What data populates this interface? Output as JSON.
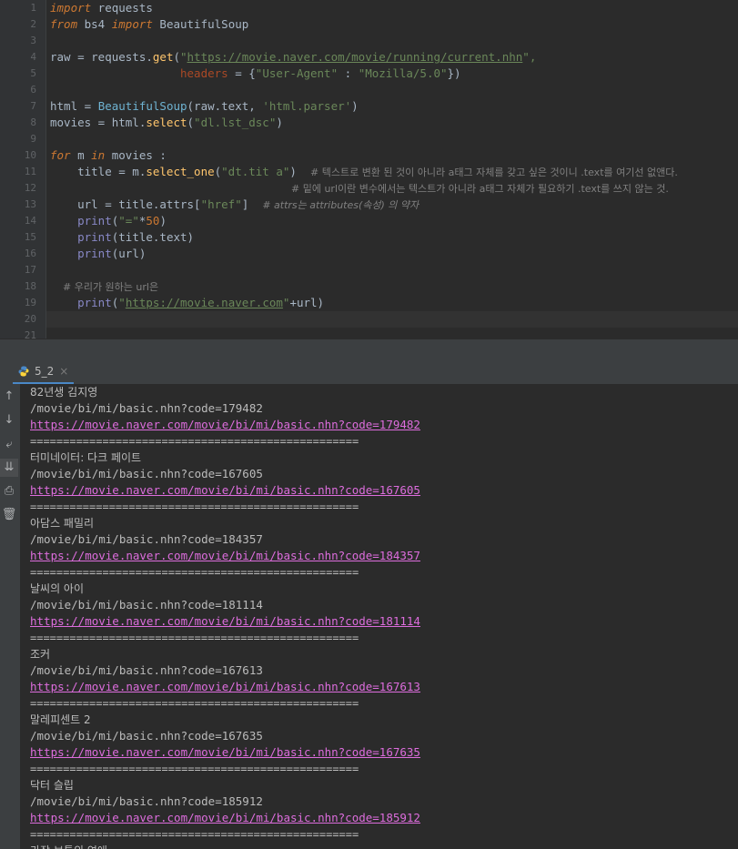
{
  "editor": {
    "line_numbers": [
      "1",
      "2",
      "3",
      "4",
      "5",
      "6",
      "7",
      "8",
      "9",
      "10",
      "11",
      "12",
      "13",
      "14",
      "15",
      "16",
      "17",
      "18",
      "19",
      "20",
      "21"
    ],
    "l1_import": "import",
    "l1_module": " requests",
    "l2_from": "from",
    "l2_bs4": " bs4 ",
    "l2_import": "import",
    "l2_bs": " BeautifulSoup",
    "l4_a": "raw = requests.",
    "l4_get": "get",
    "l4_paren": "(",
    "l4_q1": "\"",
    "l4_url": "https://movie.naver.com/movie/running/current.nhn",
    "l4_q2": "\",",
    "l5_indent": "                   ",
    "l5_headers": "headers",
    "l5_eq": " = {",
    "l5_key": "\"User-Agent\"",
    "l5_colon": " : ",
    "l5_val": "\"Mozilla/5.0\"",
    "l5_end": "})",
    "l7_a": "html = ",
    "l7_bs": "BeautifulSoup",
    "l7_b": "(raw.text, ",
    "l7_str": "'html.parser'",
    "l7_c": ")",
    "l8_a": "movies = html.",
    "l8_fn": "select",
    "l8_b": "(",
    "l8_str": "\"dl.lst_dsc\"",
    "l8_c": ")",
    "l10_for": "for",
    "l10_m": " m ",
    "l10_in": "in",
    "l10_b": " movies :",
    "l11_a": "    title = m.",
    "l11_fn": "select_one",
    "l11_b": "(",
    "l11_str": "\"dt.tit a\"",
    "l11_c": ")  ",
    "l11_cm": "# 텍스트로 변환 된 것이 아니라 a태그 자체를 갖고 싶은 것이니 .text를 여기선 없앤다.",
    "l12_cm": "# 밑에 url이란 변수에서는 텍스트가 아니라 a태그 자체가 필요하기 .text를 쓰지 않는 것.",
    "l13_a": "    url = title.attrs[",
    "l13_str": "\"href\"",
    "l13_b": "]  ",
    "l13_cm": "# attrs는 attributes(속성) 의 약자",
    "l14_a": "    ",
    "l14_print": "print",
    "l14_b": "(",
    "l14_str": "\"=\"",
    "l14_c": "*",
    "l14_num": "50",
    "l14_d": ")",
    "l15_a": "    ",
    "l15_print": "print",
    "l15_b": "(title.text)",
    "l16_a": "    ",
    "l16_print": "print",
    "l16_b": "(url)",
    "l18_cm": "    # 우리가 원하는 url은",
    "l19_a": "    ",
    "l19_print": "print",
    "l19_b": "(",
    "l19_q1": "\"",
    "l19_url": "https://movie.naver.com",
    "l19_q2": "\"",
    "l19_c": "+url)"
  },
  "tab": {
    "label": "5_2",
    "close": "×"
  },
  "tools": {
    "up": "↑",
    "down": "↓",
    "wrap": "⤶",
    "scroll": "⇊",
    "print": "⎙",
    "trash": "🗑"
  },
  "console": {
    "lines": [
      {
        "text": "82년생 김지영",
        "kind": "title"
      },
      {
        "text": "/movie/bi/mi/basic.nhn?code=179482",
        "kind": "path"
      },
      {
        "text": "https://movie.naver.com/movie/bi/mi/basic.nhn?code=179482",
        "kind": "link"
      },
      {
        "text": "==================================================",
        "kind": "sep"
      },
      {
        "text": "터미네이터: 다크 페이트",
        "kind": "title"
      },
      {
        "text": "/movie/bi/mi/basic.nhn?code=167605",
        "kind": "path"
      },
      {
        "text": "https://movie.naver.com/movie/bi/mi/basic.nhn?code=167605",
        "kind": "link"
      },
      {
        "text": "==================================================",
        "kind": "sep"
      },
      {
        "text": "아담스 패밀리",
        "kind": "title"
      },
      {
        "text": "/movie/bi/mi/basic.nhn?code=184357",
        "kind": "path"
      },
      {
        "text": "https://movie.naver.com/movie/bi/mi/basic.nhn?code=184357",
        "kind": "link"
      },
      {
        "text": "==================================================",
        "kind": "sep"
      },
      {
        "text": "날씨의 아이",
        "kind": "title"
      },
      {
        "text": "/movie/bi/mi/basic.nhn?code=181114",
        "kind": "path"
      },
      {
        "text": "https://movie.naver.com/movie/bi/mi/basic.nhn?code=181114",
        "kind": "link"
      },
      {
        "text": "==================================================",
        "kind": "sep"
      },
      {
        "text": "조커",
        "kind": "title"
      },
      {
        "text": "/movie/bi/mi/basic.nhn?code=167613",
        "kind": "path"
      },
      {
        "text": "https://movie.naver.com/movie/bi/mi/basic.nhn?code=167613",
        "kind": "link"
      },
      {
        "text": "==================================================",
        "kind": "sep"
      },
      {
        "text": "말레피센트 2",
        "kind": "title"
      },
      {
        "text": "/movie/bi/mi/basic.nhn?code=167635",
        "kind": "path"
      },
      {
        "text": "https://movie.naver.com/movie/bi/mi/basic.nhn?code=167635",
        "kind": "link"
      },
      {
        "text": "==================================================",
        "kind": "sep"
      },
      {
        "text": "닥터 슬립",
        "kind": "title"
      },
      {
        "text": "/movie/bi/mi/basic.nhn?code=185912",
        "kind": "path"
      },
      {
        "text": "https://movie.naver.com/movie/bi/mi/basic.nhn?code=185912",
        "kind": "link"
      },
      {
        "text": "==================================================",
        "kind": "sep"
      },
      {
        "text": "가장 보통의 연애",
        "kind": "title"
      }
    ]
  }
}
